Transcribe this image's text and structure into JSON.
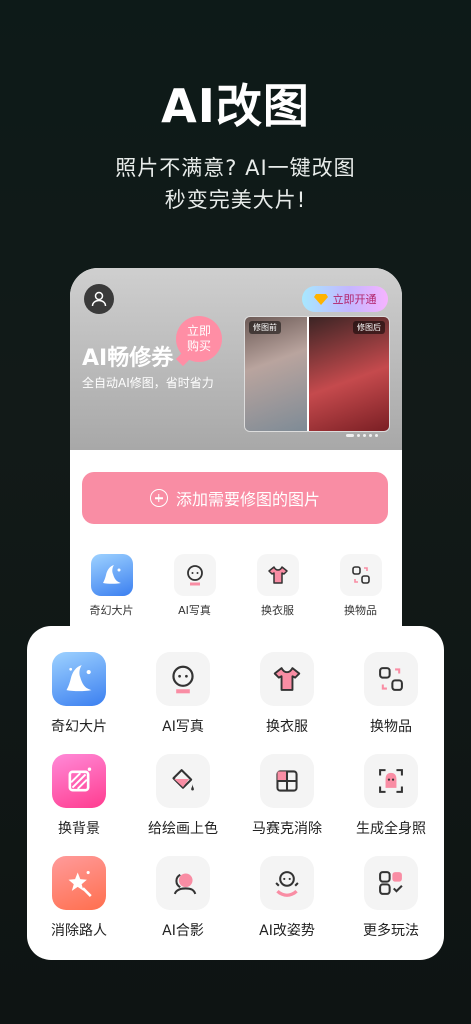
{
  "hero": {
    "title": "AI改图",
    "subtitle_line1": "照片不满意? AI一键改图",
    "subtitle_line2": "秒变完美大片!"
  },
  "banner": {
    "vip_label": "立即开通",
    "title": "AI畅修券",
    "buy_label": "立即购买",
    "description": "全自动AI修图，省时省力",
    "before_tag": "修图前",
    "after_tag": "修图后"
  },
  "add_button": {
    "label": "添加需要修图的图片"
  },
  "mini_tools": [
    {
      "label": "奇幻大片",
      "icon": "wizard-hat-icon"
    },
    {
      "label": "AI写真",
      "icon": "portrait-icon"
    },
    {
      "label": "换衣服",
      "icon": "tshirt-icon"
    },
    {
      "label": "换物品",
      "icon": "swap-objects-icon"
    }
  ],
  "tools": [
    {
      "label": "奇幻大片",
      "icon": "wizard-hat-icon"
    },
    {
      "label": "AI写真",
      "icon": "portrait-icon"
    },
    {
      "label": "换衣服",
      "icon": "tshirt-icon"
    },
    {
      "label": "换物品",
      "icon": "swap-objects-icon"
    },
    {
      "label": "换背景",
      "icon": "background-icon"
    },
    {
      "label": "给绘画上色",
      "icon": "paint-bucket-icon"
    },
    {
      "label": "马赛克消除",
      "icon": "mosaic-icon"
    },
    {
      "label": "生成全身照",
      "icon": "full-body-scan-icon"
    },
    {
      "label": "消除路人",
      "icon": "magic-star-icon"
    },
    {
      "label": "AI合影",
      "icon": "group-photo-icon"
    },
    {
      "label": "AI改姿势",
      "icon": "pose-icon"
    },
    {
      "label": "更多玩法",
      "icon": "more-apps-icon"
    }
  ],
  "colors": {
    "accent_pink": "#f98da4",
    "background": "#0e1413"
  }
}
